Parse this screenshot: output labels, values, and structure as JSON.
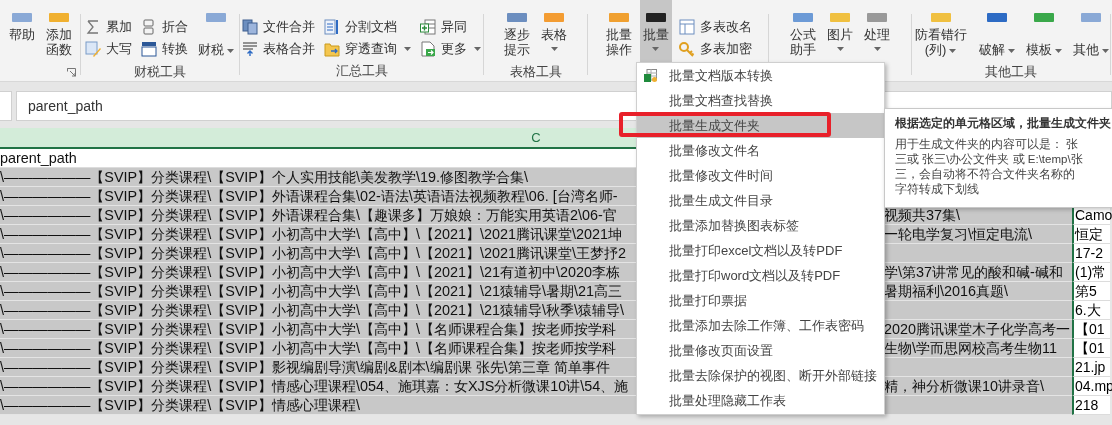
{
  "ribbon": {
    "groups": [
      {
        "columns": [
          {
            "kind": "large",
            "label": "帮助",
            "dropdown": false,
            "open": false
          },
          {
            "kind": "large",
            "label": "添加函数",
            "dropdown": false,
            "open": false
          }
        ]
      },
      {
        "label": "财税工具",
        "columns": [
          {
            "kind": "stack",
            "items": [
              {
                "label": "累加",
                "dropdown": false
              },
              {
                "label": "大写",
                "dropdown": false
              }
            ]
          },
          {
            "kind": "stack",
            "items": [
              {
                "label": "折合",
                "dropdown": false
              },
              {
                "label": "转换",
                "dropdown": false
              }
            ]
          },
          {
            "kind": "bottom",
            "label": "财税",
            "dropdown": true,
            "open": false
          }
        ]
      },
      {
        "label": "汇总工具",
        "columns": [
          {
            "kind": "stack",
            "items": [
              {
                "label": "文件合并",
                "dropdown": false
              },
              {
                "label": "表格合并",
                "dropdown": false
              }
            ]
          },
          {
            "kind": "stack",
            "items": [
              {
                "label": "分割文档",
                "dropdown": false
              },
              {
                "label": "穿透查询",
                "dropdown": true
              }
            ]
          },
          {
            "kind": "stack",
            "items": [
              {
                "label": "异同",
                "dropdown": false
              },
              {
                "label": "更多",
                "dropdown": true
              }
            ]
          }
        ]
      },
      {
        "label": "表格工具",
        "columns": [
          {
            "kind": "large",
            "label": "逐步提示",
            "dropdown": false,
            "open": false
          },
          {
            "kind": "large",
            "label": "表格",
            "dropdown": true,
            "open": false
          }
        ]
      },
      {
        "columns": [
          {
            "kind": "large",
            "label": "批量操作",
            "dropdown": false,
            "open": false
          },
          {
            "kind": "large",
            "label": "批量",
            "dropdown": true,
            "open": true
          },
          {
            "kind": "stack",
            "items": [
              {
                "label": "多表改名",
                "dropdown": false
              },
              {
                "label": "多表加密",
                "dropdown": false
              }
            ]
          }
        ]
      },
      {
        "columns": [
          {
            "kind": "large",
            "label": "公式助手",
            "dropdown": false,
            "open": false
          },
          {
            "kind": "large",
            "label": "图片",
            "dropdown": true,
            "open": false
          },
          {
            "kind": "large",
            "label": "处理",
            "dropdown": true,
            "open": false
          }
        ]
      },
      {
        "label": "其他工具",
        "columns": [
          {
            "kind": "large",
            "label": "防看错行(列)",
            "dropdown": true,
            "open": false
          },
          {
            "kind": "bottom",
            "label": "破解",
            "dropdown": true,
            "open": false
          },
          {
            "kind": "bottom",
            "label": "模板",
            "dropdown": true,
            "open": false
          },
          {
            "kind": "bottom",
            "label": "其他",
            "dropdown": true,
            "open": false
          }
        ]
      }
    ]
  },
  "formula_bar": {
    "value": "parent_path"
  },
  "sheet": {
    "column_header": "C",
    "rows": [
      {
        "selected": false,
        "c_left": "parent_path"
      },
      {
        "selected": true,
        "c_left": "\\——————【SVIP】分类课程\\【SVIP】个人实用技能\\美发教学\\19.修图教学合集\\"
      },
      {
        "selected": true,
        "c_left": "\\——————【SVIP】分类课程\\【SVIP】外语课程合集\\02-语法\\英语语法视频教程\\06. [台湾名师-"
      },
      {
        "selected": true,
        "c_left": "\\——————【SVIP】分类课程\\【SVIP】外语课程合集\\【趣课多】万娘娘：万能实用英语2\\06-官",
        "c_right": "视频共37集\\",
        "d": "Camo"
      },
      {
        "selected": true,
        "c_left": "\\——————【SVIP】分类课程\\【SVIP】小初高中大学\\【高中】\\【2021】\\2021腾讯课堂\\2021坤",
        "c_right": "一轮电学复习\\恒定电流\\",
        "d": "恒定"
      },
      {
        "selected": true,
        "c_left": "\\——————【SVIP】分类课程\\【SVIP】小初高中大学\\【高中】\\【2021】\\2021腾讯课堂\\王梦抒2",
        "d": "17-2"
      },
      {
        "selected": true,
        "c_left": "\\——————【SVIP】分类课程\\【SVIP】小初高中大学\\【高中】\\【2021】\\21有道初中\\2020李栋",
        "c_right": "学\\第37讲常见的酸和碱-碱和",
        "d": "(1)常"
      },
      {
        "selected": true,
        "c_left": "\\——————【SVIP】分类课程\\【SVIP】小初高中大学\\【高中】\\【2021】\\21猿辅导\\暑期\\21高三",
        "c_right": "暑期福利\\2016真题\\",
        "d": "第5"
      },
      {
        "selected": true,
        "c_left": "\\——————【SVIP】分类课程\\【SVIP】小初高中大学\\【高中】\\【2021】\\21猿辅导\\秋季\\猿辅导\\",
        "d": "6.大"
      },
      {
        "selected": true,
        "c_left": "\\——————【SVIP】分类课程\\【SVIP】小初高中大学\\【高中】\\【名师课程合集】按老师按学科",
        "c_right": "2020腾讯课堂木子化学高考一",
        "d": "【01"
      },
      {
        "selected": true,
        "c_left": "\\——————【SVIP】分类课程\\【SVIP】小初高中大学\\【高中】\\【名师课程合集】按老师按学科",
        "c_right": "生物\\学而思网校高考生物11",
        "d": "【01"
      },
      {
        "selected": true,
        "c_left": "\\——————【SVIP】分类课程\\【SVIP】影视编剧导演\\编剧&剧本\\编剧课 张先\\第三章 简单事件",
        "d": "21.jp"
      },
      {
        "selected": true,
        "c_left": "\\——————【SVIP】分类课程\\【SVIP】情感心理课程\\054、施琪嘉：女XJS分析微课10讲\\54、施",
        "c_right": "精，神分析微课10讲录音\\",
        "d": "04.mp"
      },
      {
        "selected": true,
        "c_left": "\\——————【SVIP】分类课程\\【SVIP】情感心理课程\\",
        "d": "218"
      }
    ]
  },
  "menu": {
    "items": [
      {
        "label": "批量文档版本转换",
        "selected": false,
        "framed": false
      },
      {
        "label": "批量文档查找替换",
        "selected": false,
        "framed": false
      },
      {
        "label": "批量生成文件夹",
        "selected": true,
        "framed": true
      },
      {
        "label": "批量修改文件名",
        "selected": false,
        "framed": false
      },
      {
        "label": "批量修改文件时间",
        "selected": false,
        "framed": false
      },
      {
        "label": "批量生成文件目录",
        "selected": false,
        "framed": false
      },
      {
        "label": "批量添加替换图表标签",
        "selected": false,
        "framed": false
      },
      {
        "label": "批量打印excel文档以及转PDF",
        "selected": false,
        "framed": false
      },
      {
        "label": "批量打印word文档以及转PDF",
        "selected": false,
        "framed": false
      },
      {
        "label": "批量打印票据",
        "selected": false,
        "framed": false
      },
      {
        "label": "批量添加去除工作簿、工作表密码",
        "selected": false,
        "framed": false
      },
      {
        "label": "批量修改页面设置",
        "selected": false,
        "framed": false
      },
      {
        "label": "批量去除保护的视图、断开外部链接",
        "selected": false,
        "framed": false
      },
      {
        "label": "批量处理隐藏工作表",
        "selected": false,
        "framed": false
      }
    ]
  },
  "tooltip": {
    "title": "根据选定的单元格区域，批量生成文件夹",
    "body": "用于生成文件夹的内容可以是： 张三或 张三\\办公文件夹 或 E:\\temp\\张三，会自动将不符合文件夹名称的字符转成下划线"
  }
}
